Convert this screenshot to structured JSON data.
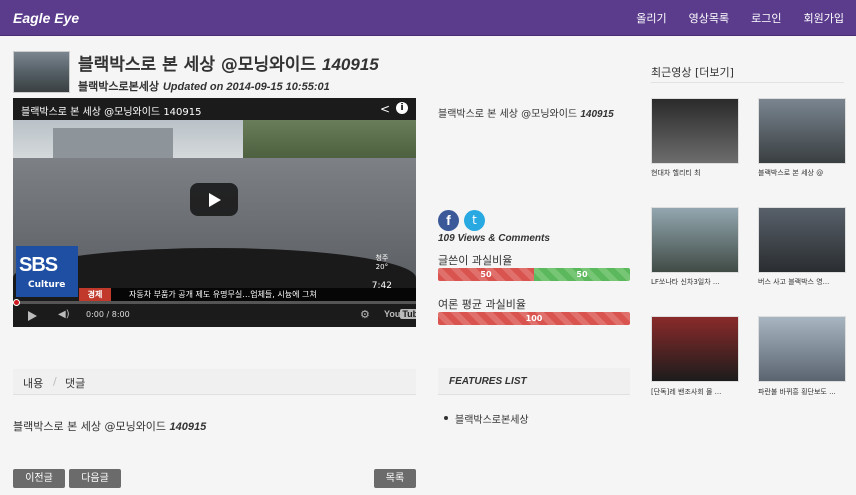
{
  "app": {
    "brand": "Eagle Eye"
  },
  "nav": {
    "items": [
      "올리기",
      "영상목록",
      "로그인",
      "회원가입"
    ]
  },
  "post": {
    "title_text": "블랙박스로 본 세상 @모닝와이드 ",
    "title_num": "140915",
    "author": "블랙박스로본세상",
    "updated": "Updated on 2014-09-15 10:55:01"
  },
  "video": {
    "title": "블랙박스로 본 세상 @모닝와이드 140915",
    "sbs_logo": "SBS",
    "sbs_sub": "Culture",
    "ticker_category": "경제",
    "ticker_text": "자동차 부품가 공개 제도 유명무실…업체들, 시늉에 그쳐",
    "weather_city": "청주",
    "weather_temp": "20°",
    "clock": "7:42",
    "time": "0:00 / 8:00",
    "youtube_label": "You",
    "youtube_tube": "Tube"
  },
  "info": {
    "title_text": "블랙박스로 본 세상 @모닝와이드 ",
    "title_num": "140915",
    "views": "109 Views & Comments",
    "bar1_label": "글쓴이 과실비율",
    "bar1_left": "50",
    "bar1_right": "50",
    "bar1_fraction": 0.5,
    "bar2_label": "여론 평균 과실비율",
    "bar2_value": "100",
    "bar2_fraction": 1.0
  },
  "recent": {
    "title": "최근영상 [더보기]",
    "items": [
      {
        "caption": "현대차 헬리티 최",
        "colors": [
          "#2a2a2a",
          "#6d6d6d"
        ]
      },
      {
        "caption": "블랙박스로 본 세상 @",
        "colors": [
          "#7a8590",
          "#3a3f41"
        ]
      },
      {
        "caption": "LF쏘나타 신차3일차 ...",
        "colors": [
          "#93a7b0",
          "#404b45"
        ]
      },
      {
        "caption": "버스 사고 블랙박스 영...",
        "colors": [
          "#58606a",
          "#2a2d30"
        ]
      },
      {
        "caption": "[단독]레 밴조사회 몰 ...",
        "colors": [
          "#8a2a2a",
          "#1c1c1c"
        ]
      },
      {
        "caption": "파란불 바뀌흥 횡단보도 ...",
        "colors": [
          "#a8b6c2",
          "#5a6470"
        ]
      }
    ]
  },
  "tabs": {
    "content": "내용",
    "separator": "/",
    "comments": "댓글"
  },
  "description": {
    "text": "블랙박스로 본 세상 @모닝와이드 ",
    "num": "140915"
  },
  "features": {
    "title": "FEATURES LIST",
    "items": [
      "블랙박스로본세상"
    ]
  },
  "buttons": {
    "prev": "이전글",
    "next": "다음글",
    "list": "목록"
  },
  "icons": {
    "facebook": "facebook-icon",
    "twitter": "twitter-icon",
    "share": "share-icon",
    "info": "info-icon"
  }
}
